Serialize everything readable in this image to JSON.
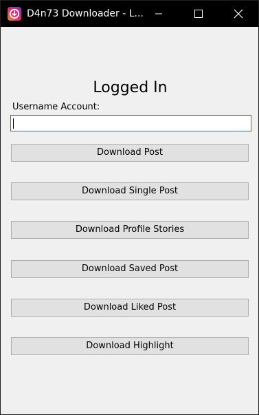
{
  "window": {
    "title": "D4n73 Downloader - L..."
  },
  "title_bar": {
    "app_icon": "download-icon",
    "minimize_icon": "minimize-icon",
    "maximize_icon": "maximize-icon",
    "close_icon": "close-icon"
  },
  "main": {
    "heading": "Logged In",
    "username_label": "Username Account:",
    "username_value": "",
    "buttons": [
      {
        "label": "Download Post"
      },
      {
        "label": "Download Single Post"
      },
      {
        "label": "Download Profile Stories"
      },
      {
        "label": "Download Saved Post"
      },
      {
        "label": "Download Liked Post"
      },
      {
        "label": "Download Highlight"
      }
    ]
  },
  "colors": {
    "titlebar_bg": "#000000",
    "window_bg": "#f0f0f0",
    "button_bg": "#e1e1e1",
    "button_border": "#adadad",
    "input_focus_border": "#0078d7",
    "icon_gradient_start": "#f58529",
    "icon_gradient_end": "#c13584"
  }
}
